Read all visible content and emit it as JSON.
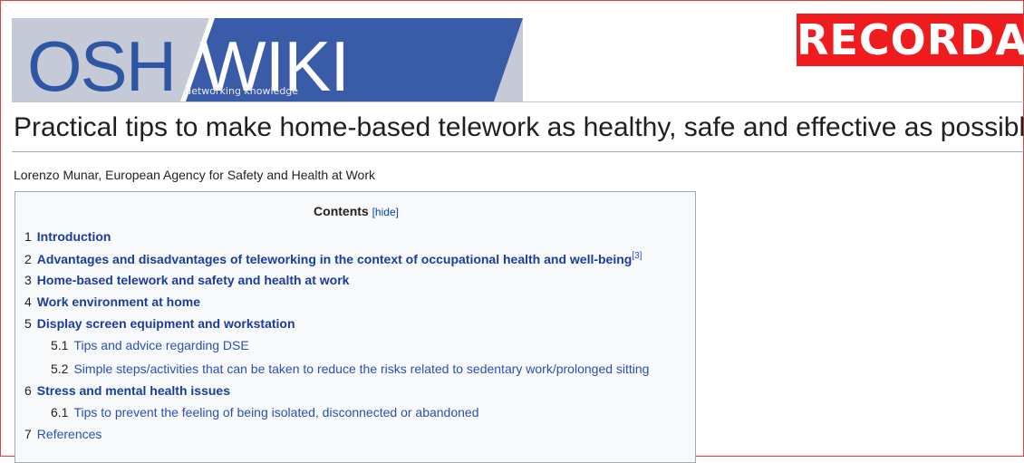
{
  "logo": {
    "part1": "OSH",
    "part2": "WIKI",
    "tagline": "Networking knowledge"
  },
  "badge": "RECORDA",
  "page": {
    "title": "Practical tips to make home-based telework as healthy, safe and effective as possible",
    "byline": "Lorenzo Munar, European Agency for Safety and Health at Work"
  },
  "toc": {
    "title": "Contents",
    "hide_label": "[hide]",
    "items": [
      {
        "num": "1",
        "label": "Introduction",
        "sup": ""
      },
      {
        "num": "2",
        "label": "Advantages and disadvantages of teleworking in the context of occupational health and well-being",
        "sup": "[3]"
      },
      {
        "num": "3",
        "label": "Home-based telework and safety and health at work",
        "sup": ""
      },
      {
        "num": "4",
        "label": "Work environment at home",
        "sup": ""
      },
      {
        "num": "5",
        "label": "Display screen equipment and workstation",
        "sup": ""
      },
      {
        "num": "5.1",
        "label": "Tips and advice regarding DSE",
        "sup": ""
      },
      {
        "num": "5.2",
        "label": "Simple steps/activities that can be taken to reduce the risks related to sedentary work/prolonged sitting",
        "sup": ""
      },
      {
        "num": "6",
        "label": "Stress and mental health issues",
        "sup": ""
      },
      {
        "num": "6.1",
        "label": "Tips to prevent the feeling of being isolated, disconnected or abandoned",
        "sup": ""
      },
      {
        "num": "7",
        "label": "References",
        "sup": ""
      }
    ]
  },
  "colors": {
    "logo_blue": "#2f56a3",
    "banner_gray": "#c6cad6",
    "badge_red": "#ee1c1c",
    "link_blue": "#1a3c9e"
  }
}
